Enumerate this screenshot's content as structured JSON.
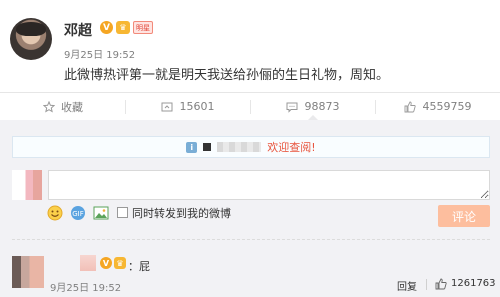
{
  "post": {
    "username": "邓超",
    "badge_v": "V",
    "badge_crown": "明星",
    "timestamp": "9月25日 19:52",
    "text": "此微博热评第一就是明天我送给孙俪的生日礼物，周知。"
  },
  "actions": [
    {
      "icon": "star-icon",
      "label": "收藏"
    },
    {
      "icon": "share-icon",
      "label": "15601"
    },
    {
      "icon": "comment-icon",
      "label": "98873"
    },
    {
      "icon": "thumbs-up-icon",
      "label": "4559759"
    }
  ],
  "comment_box": {
    "notice_text": "欢迎查阅!",
    "input_value": "",
    "repost_label": "同时转发到我的微博",
    "submit_label": "评论",
    "tools": [
      "smile-icon",
      "friends-icon",
      "image-icon"
    ]
  },
  "comment": {
    "badge_v": "V",
    "text": "：屁",
    "time": "9月25日 19:52",
    "reply_label": "回复",
    "like_count": "1261763"
  },
  "colors": {
    "accent_orange": "#e8553e",
    "submit_disabled": "#fdbe9e",
    "badge_gold": "#f5a623"
  }
}
